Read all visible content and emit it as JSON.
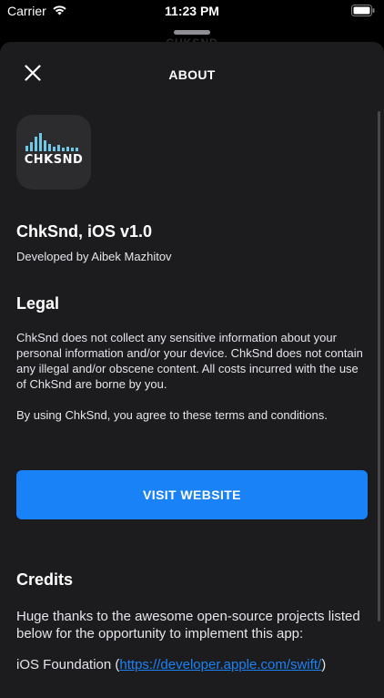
{
  "status_bar": {
    "carrier": "Carrier",
    "time": "11:23 PM"
  },
  "background_title": "CHKSND",
  "nav": {
    "title": "ABOUT"
  },
  "app": {
    "icon_wordmark": "CHKSND",
    "name": "ChkSnd, iOS v1.0",
    "developer": "Developed by Aibek Mazhitov"
  },
  "legal": {
    "title": "Legal",
    "paragraph1": "ChkSnd does not collect any sensitive information about your personal information and/or your device. ChkSnd does not contain any illegal and/or obscene content. All costs incurred with the use of ChkSnd are borne by you.",
    "paragraph2": "By using ChkSnd, you agree to these terms and conditions."
  },
  "visit_button": {
    "label": "VISIT WEBSITE"
  },
  "credits": {
    "title": "Credits",
    "intro": "Huge thanks to the awesome open-source projects listed below for the opportunity to implement this app:",
    "items": [
      {
        "name": "iOS Foundation (",
        "link": "https://developer.apple.com/swift/",
        "suffix": ")"
      }
    ]
  },
  "colors": {
    "accent": "#1a82f7",
    "sheet_background": "#1c1c1e",
    "icon_background": "#2c2c2e",
    "icon_bars": "#6fc9e6"
  },
  "icons": {
    "close": "close-icon",
    "wifi": "wifi-icon",
    "battery": "battery-icon",
    "app_logo": "sound-bars-icon"
  }
}
